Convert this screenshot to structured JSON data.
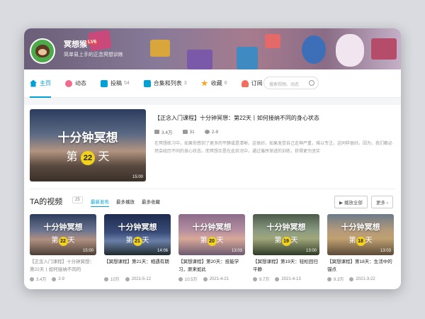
{
  "profile": {
    "name": "冥想猴",
    "level": "LV6",
    "sign": "简单易上手的正念冥想训练"
  },
  "nav": [
    {
      "label": "主页",
      "count": "",
      "icon": "home-icon",
      "color": "#00a1d6",
      "active": true
    },
    {
      "label": "动态",
      "count": "",
      "icon": "flower-icon",
      "color": "#f36b8c"
    },
    {
      "label": "投稿",
      "count": "54",
      "icon": "grid-icon",
      "color": "#00a1d6"
    },
    {
      "label": "合集和列表",
      "count": "3",
      "icon": "collection-icon",
      "color": "#00a1d6"
    },
    {
      "label": "收藏",
      "count": "6",
      "icon": "star-icon",
      "color": "#f5a623"
    },
    {
      "label": "订阅",
      "count": "",
      "icon": "heart-icon",
      "color": "#f56d5b"
    }
  ],
  "search": {
    "placeholder": "搜索视频、动态"
  },
  "featured": {
    "thumb_title": "十分钟冥想",
    "thumb_prefix": "第",
    "thumb_day": "22",
    "thumb_suffix": "天",
    "duration": "15:00",
    "title": "【正念入门课程】十分钟冥想：第22天丨如何接纳不同的身心状态",
    "views": "3.4万",
    "danmaku": "31",
    "date": "2-9",
    "desc": "在冥想练习中，如果你感到了更多的平静或是清晰，这很好。如果发觉自己走神严重，难以专注，这同样很好。因为，我们都必然会经历不同的身心状态。而冥想正是在此状况中，通过循序渐进的训练，获得更为坚实"
  },
  "section": {
    "title": "TA的视频",
    "count": "25",
    "sorts": [
      "最新发布",
      "最多播放",
      "最多收藏"
    ],
    "play_all": "播放全部",
    "more": "更多"
  },
  "videos": [
    {
      "day": "22",
      "duration": "15:00",
      "title": "【正念入门课程】十分钟冥想：第22天丨如何接纳不同的",
      "views": "3.4万",
      "date": "2-9"
    },
    {
      "day": "21",
      "duration": "14:06",
      "title": "【冥想课程】第21天：相遇有期",
      "views": "10万",
      "date": "2021-5-12"
    },
    {
      "day": "20",
      "duration": "13:03",
      "title": "【冥想课程】第20天：技能学习，原来如此",
      "views": "10.5万",
      "date": "2021-4-21"
    },
    {
      "day": "19",
      "duration": "13:00",
      "title": "【冥想课程】第19天：轻松回归平静",
      "views": "9.7万",
      "date": "2021-4-13"
    },
    {
      "day": "18",
      "duration": "13:03",
      "title": "【冥想课程】第18天：生活中的锚点",
      "views": "9.3万",
      "date": "2021-3-22"
    }
  ],
  "video_thumb": {
    "title": "十分钟冥想",
    "prefix": "第",
    "suffix": "天"
  }
}
